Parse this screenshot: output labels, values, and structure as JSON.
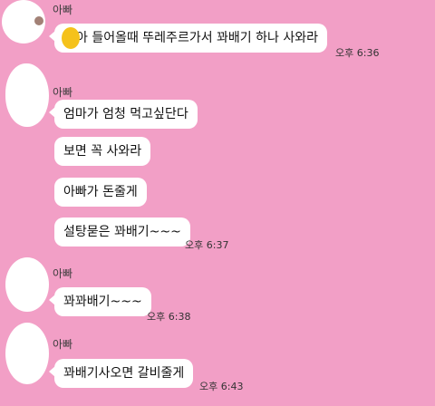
{
  "messages": [
    {
      "sender": "아빠",
      "text": "아 들어올때 뚜레주르가서 꽈배기 하나 사와라",
      "time": "오후 6:36"
    },
    {
      "sender": "아빠",
      "text": "엄마가 엄청 먹고싶단다"
    },
    {
      "text": "보면 꼭 사와라"
    },
    {
      "text": "아빠가 돈줄게"
    },
    {
      "text": "설탕묻은 꽈배기~~~",
      "time": "오후 6:37"
    },
    {
      "sender": "아빠",
      "text": "꽈꽈배기~~~",
      "time": "오후 6:38"
    },
    {
      "sender": "아빠",
      "text": "꽈배기사오면 갈비줄게",
      "time": "오후 6:43"
    }
  ]
}
